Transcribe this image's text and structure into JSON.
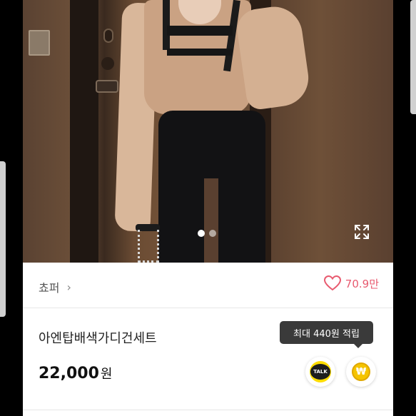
{
  "gallery": {
    "image_alt": "product photo",
    "current_index": 1,
    "total": 2
  },
  "shop": {
    "name": "쵸퍼",
    "chevron": "›",
    "likes": "70.9만",
    "heart_color": "#e85a6f"
  },
  "product": {
    "title": "아엔탑배색가디건세트",
    "price_number": "22,000",
    "price_unit": "원"
  },
  "reward": {
    "tooltip": "최대 440원 적립"
  },
  "actions": {
    "talk_label": "TALK",
    "pay_symbol": "₩"
  },
  "icons": {
    "expand": "expand-icon",
    "heart": "heart-icon",
    "talk": "kakao-talk-icon",
    "pay": "won-coin-icon"
  }
}
